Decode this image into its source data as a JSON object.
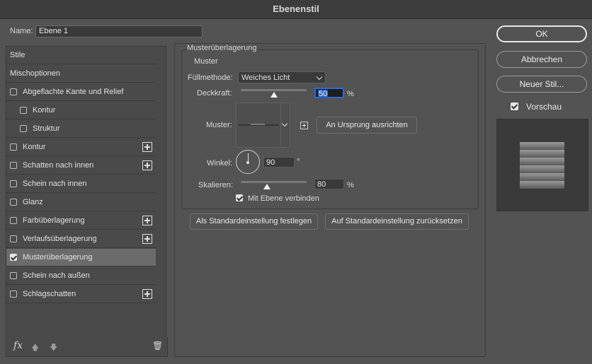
{
  "window": {
    "title": "Ebenenstil"
  },
  "name": {
    "label": "Name:",
    "value": "Ebene 1"
  },
  "styles_list": [
    {
      "label": "Stile",
      "checkbox": false,
      "checked": false,
      "indent": 0,
      "plus": false,
      "selected": false
    },
    {
      "label": "Mischoptionen",
      "checkbox": false,
      "checked": false,
      "indent": 0,
      "plus": false,
      "selected": false
    },
    {
      "label": "Abgeflachte Kante und Relief",
      "checkbox": true,
      "checked": false,
      "indent": 0,
      "plus": false,
      "selected": false
    },
    {
      "label": "Kontur",
      "checkbox": true,
      "checked": false,
      "indent": 1,
      "plus": false,
      "selected": false
    },
    {
      "label": "Struktur",
      "checkbox": true,
      "checked": false,
      "indent": 1,
      "plus": false,
      "selected": false
    },
    {
      "label": "Kontur",
      "checkbox": true,
      "checked": false,
      "indent": 0,
      "plus": true,
      "selected": false
    },
    {
      "label": "Schatten nach innen",
      "checkbox": true,
      "checked": false,
      "indent": 0,
      "plus": true,
      "selected": false
    },
    {
      "label": "Schein nach innen",
      "checkbox": true,
      "checked": false,
      "indent": 0,
      "plus": false,
      "selected": false
    },
    {
      "label": "Glanz",
      "checkbox": true,
      "checked": false,
      "indent": 0,
      "plus": false,
      "selected": false
    },
    {
      "label": "Farbüberlagerung",
      "checkbox": true,
      "checked": false,
      "indent": 0,
      "plus": true,
      "selected": false
    },
    {
      "label": "Verlaufsüberlagerung",
      "checkbox": true,
      "checked": false,
      "indent": 0,
      "plus": true,
      "selected": false
    },
    {
      "label": "Musterüberlagerung",
      "checkbox": true,
      "checked": true,
      "indent": 0,
      "plus": false,
      "selected": true
    },
    {
      "label": "Schein nach außen",
      "checkbox": true,
      "checked": false,
      "indent": 0,
      "plus": false,
      "selected": false
    },
    {
      "label": "Schlagschatten",
      "checkbox": true,
      "checked": false,
      "indent": 0,
      "plus": true,
      "selected": false
    }
  ],
  "bottombar": {
    "fx": "fx",
    "up_arrow": "🡅",
    "down_arrow": "🡇",
    "trash": "🗑"
  },
  "main": {
    "section_title": "Musterüberlagerung",
    "group_title": "Muster",
    "blend_mode": {
      "label": "Füllmethode:",
      "value": "Weiches Licht"
    },
    "opacity": {
      "label": "Deckkraft:",
      "value": "50",
      "unit": "%",
      "fraction": 0.5
    },
    "pattern": {
      "label": "Muster:",
      "align_button": "An Ursprung ausrichten"
    },
    "angle": {
      "label": "Winkel:",
      "value": "90",
      "unit": "°"
    },
    "scale": {
      "label": "Skalieren:",
      "value": "80",
      "unit": "%",
      "fraction": 0.4
    },
    "link_layer": {
      "label": "Mit Ebene verbinden",
      "checked": true
    },
    "set_default": "Als Standardeinstellung festlegen",
    "reset_default": "Auf Standardeinstellung zurücksetzen"
  },
  "right": {
    "ok": "OK",
    "cancel": "Abbrechen",
    "new_style": "Neuer Stil...",
    "preview_label": "Vorschau",
    "preview_checked": true
  },
  "colors": {
    "accent": "#2f6bd4",
    "panel": "#535353",
    "selected_row": "#6b6b6b"
  }
}
